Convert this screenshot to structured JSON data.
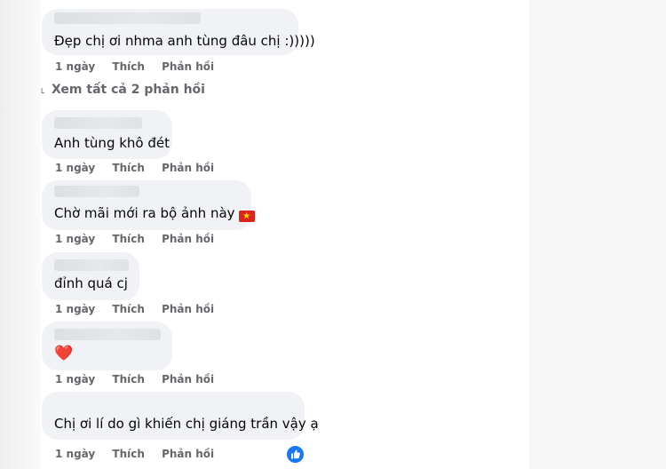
{
  "comments": [
    {
      "text": "Đẹp chị ơi nhma anh tùng đâu chị :)))))",
      "time": "1 ngày",
      "like": "Thích",
      "reply": "Phản hồi"
    },
    {
      "text": "Anh tùng khô đét",
      "time": "1 ngày",
      "like": "Thích",
      "reply": "Phản hồi"
    },
    {
      "text": "Chờ mãi mới ra bộ ảnh này",
      "flag_icon": "vietnam-flag-icon",
      "time": "1 ngày",
      "like": "Thích",
      "reply": "Phản hồi"
    },
    {
      "text": "đỉnh quá cj",
      "time": "1 ngày",
      "like": "Thích",
      "reply": "Phản hồi"
    },
    {
      "text": "❤️",
      "time": "1 ngày",
      "like": "Thích",
      "reply": "Phản hồi"
    },
    {
      "text": "Chị ơi lí do gì khiến chị giáng trần vậy ạ",
      "time": "1 ngày",
      "like": "Thích",
      "reply": "Phản hồi",
      "reaction_icon": "like-reaction-icon"
    }
  ],
  "view_all_replies": "Xem tất cả 2 phản hồi",
  "colors": {
    "bubble": "#f0f2f5",
    "secondary_text": "#65676b",
    "like_blue": "#1877f2",
    "flag_red": "#da251d"
  }
}
